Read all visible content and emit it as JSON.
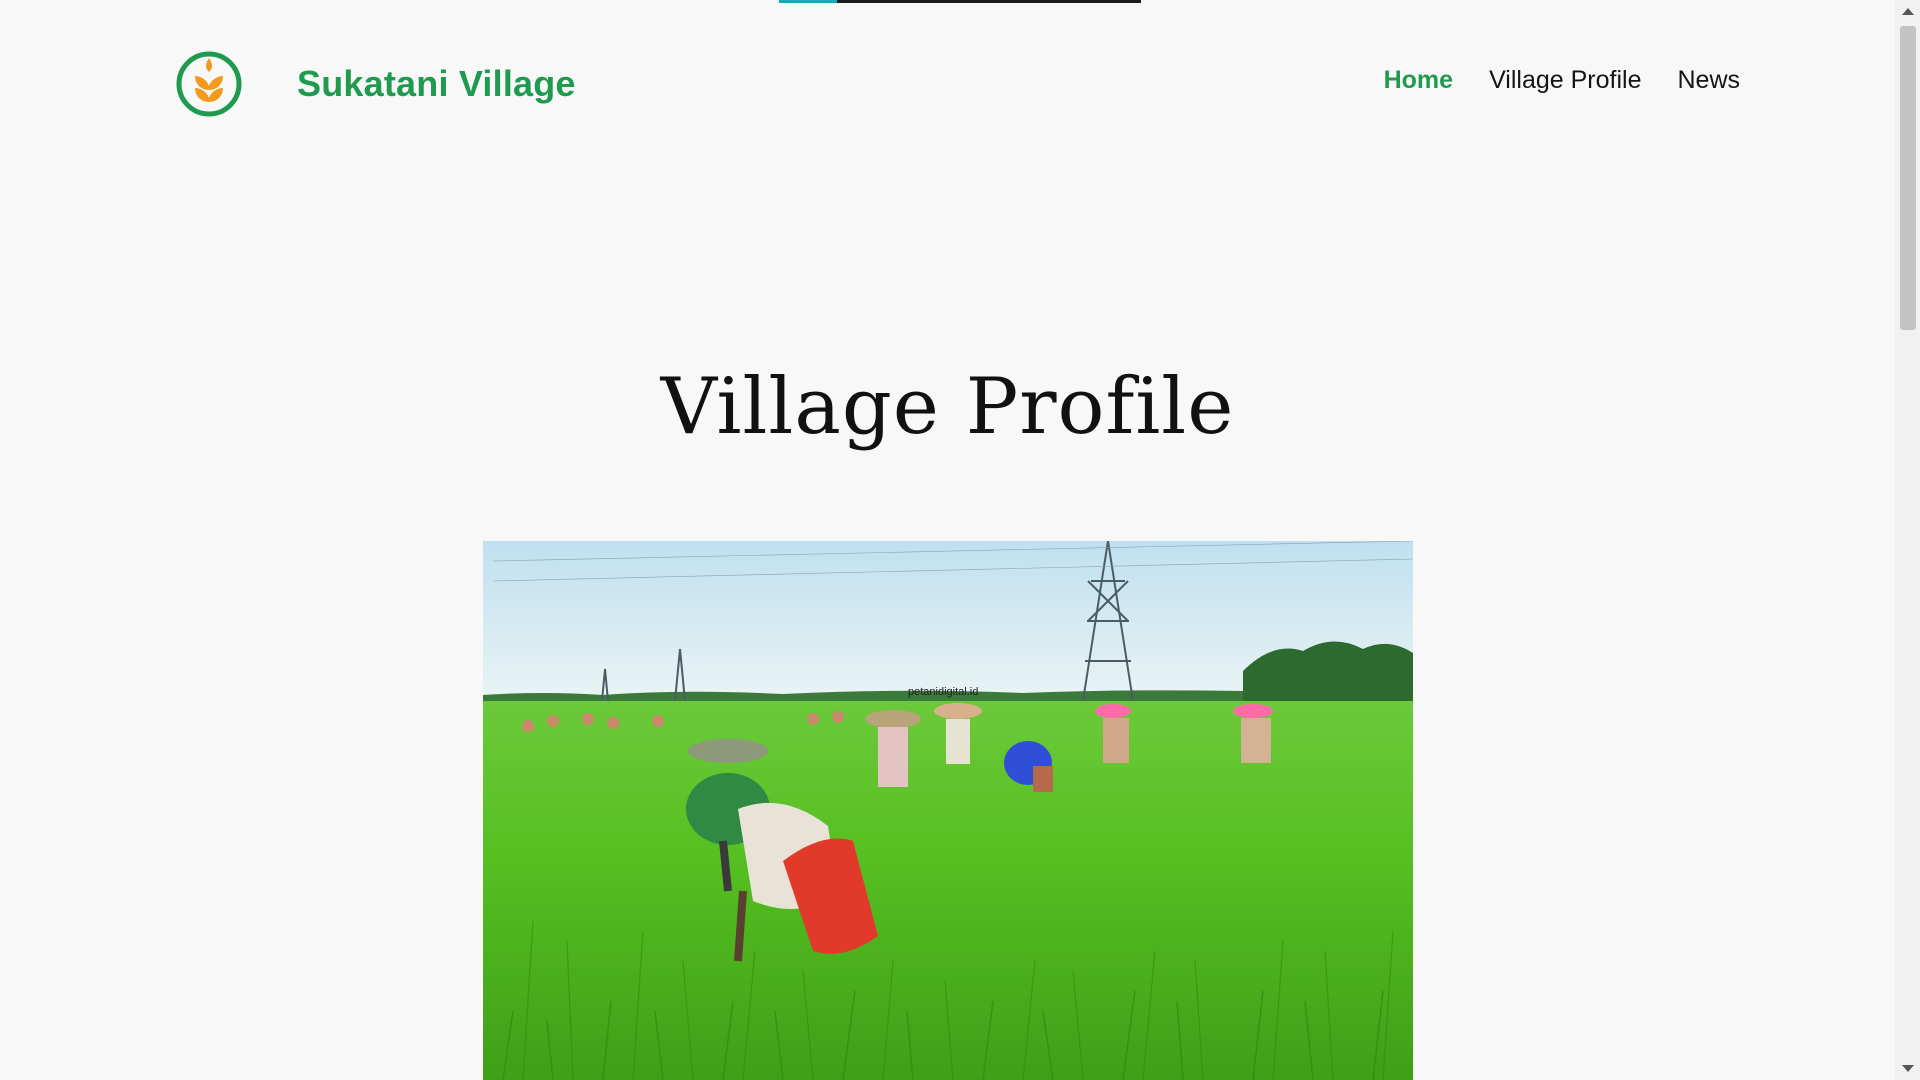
{
  "loading": {
    "progress": 0.16
  },
  "header": {
    "site_name": "Sukatani Village",
    "logo_icon": "wheat-leaf-logo-icon",
    "brand_colors": {
      "green": "#1f9a4f",
      "orange": "#f39a1e"
    }
  },
  "nav": {
    "items": [
      {
        "label": "Home",
        "active": true
      },
      {
        "label": "Village Profile",
        "active": false
      },
      {
        "label": "News",
        "active": false
      }
    ]
  },
  "main": {
    "title": "Village Profile",
    "hero_image": {
      "subject": "farmers-in-rice-field",
      "watermark": "petanidigital.id"
    }
  },
  "scrollbar": {
    "position": 0.0
  }
}
